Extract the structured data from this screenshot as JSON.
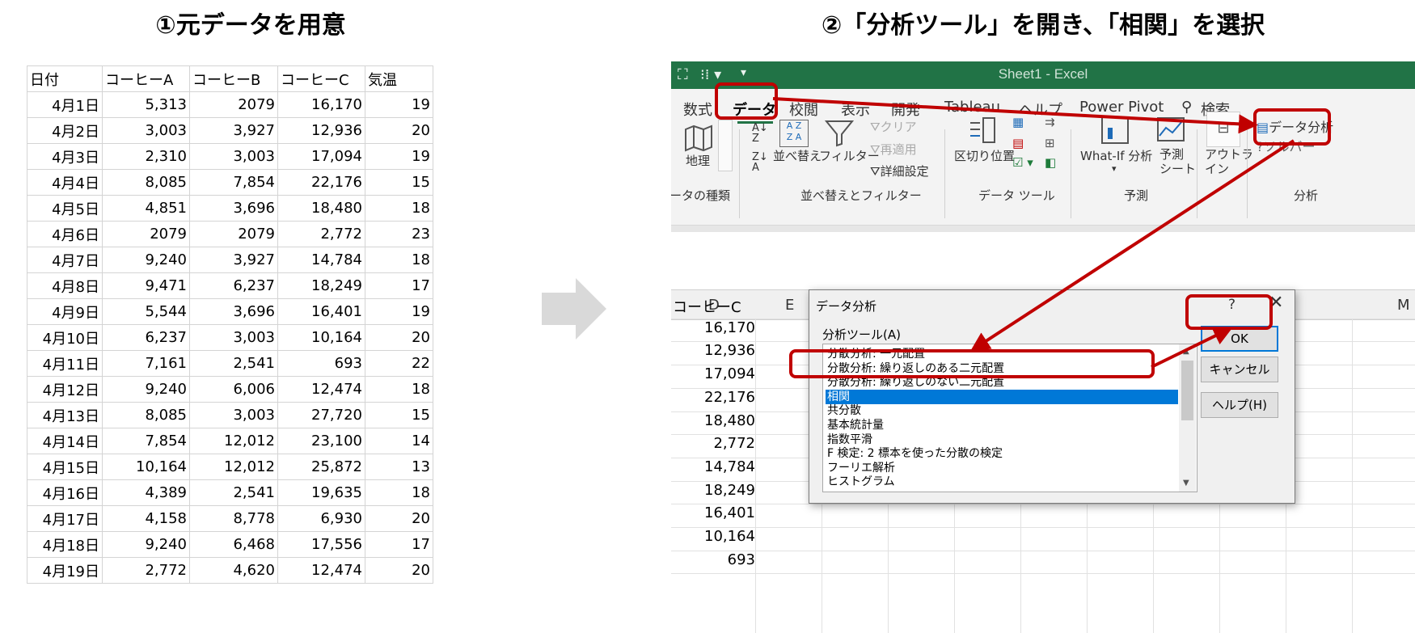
{
  "headings": {
    "step1": "①元データを用意",
    "step2": "②「分析ツール」を開き、「相関」を選択"
  },
  "source_table": {
    "headers": [
      "日付",
      "コーヒーA",
      "コーヒーB",
      "コーヒーC",
      "気温"
    ],
    "rows": [
      [
        "4月1日",
        "5,313",
        "2079",
        "16,170",
        "19"
      ],
      [
        "4月2日",
        "3,003",
        "3,927",
        "12,936",
        "20"
      ],
      [
        "4月3日",
        "2,310",
        "3,003",
        "17,094",
        "19"
      ],
      [
        "4月4日",
        "8,085",
        "7,854",
        "22,176",
        "15"
      ],
      [
        "4月5日",
        "4,851",
        "3,696",
        "18,480",
        "18"
      ],
      [
        "4月6日",
        "2079",
        "2079",
        "2,772",
        "23"
      ],
      [
        "4月7日",
        "9,240",
        "3,927",
        "14,784",
        "18"
      ],
      [
        "4月8日",
        "9,471",
        "6,237",
        "18,249",
        "17"
      ],
      [
        "4月9日",
        "5,544",
        "3,696",
        "16,401",
        "19"
      ],
      [
        "4月10日",
        "6,237",
        "3,003",
        "10,164",
        "20"
      ],
      [
        "4月11日",
        "7,161",
        "2,541",
        "693",
        "22"
      ],
      [
        "4月12日",
        "9,240",
        "6,006",
        "12,474",
        "18"
      ],
      [
        "4月13日",
        "8,085",
        "3,003",
        "27,720",
        "15"
      ],
      [
        "4月14日",
        "7,854",
        "12,012",
        "23,100",
        "14"
      ],
      [
        "4月15日",
        "10,164",
        "12,012",
        "25,872",
        "13"
      ],
      [
        "4月16日",
        "4,389",
        "2,541",
        "19,635",
        "18"
      ],
      [
        "4月17日",
        "4,158",
        "8,778",
        "6,930",
        "20"
      ],
      [
        "4月18日",
        "9,240",
        "6,468",
        "17,556",
        "17"
      ],
      [
        "4月19日",
        "2,772",
        "4,620",
        "12,474",
        "20"
      ]
    ]
  },
  "excel": {
    "title": "Sheet1  -  Excel",
    "tabs": [
      "数式",
      "データ",
      "校閲",
      "表示",
      "開発",
      "Tableau",
      "ヘルプ",
      "Power Pivot",
      "検索"
    ],
    "ribbon": {
      "geo": "地理",
      "sort": "並べ替え",
      "filter": "フィルター",
      "clear": "クリア",
      "reapply": "再適用",
      "advanced": "詳細設定",
      "text_to_columns": "区切り位置",
      "whatif": "What-If 分析",
      "forecast": "予測\nシート",
      "outline": "アウトラ\nイン",
      "data_analysis": "データ分析",
      "solver": "ソルバー",
      "group_types": "ータの種類",
      "group_sort": "並べ替えとフィルター",
      "group_tools": "データ ツール",
      "group_forecast": "予測",
      "group_analysis": "分析"
    },
    "columns": [
      "D",
      "E",
      "M"
    ],
    "col_d_header": "コーヒーC",
    "col_d_values": [
      "16,170",
      "12,936",
      "17,094",
      "22,176",
      "18,480",
      "2,772",
      "14,784",
      "18,249",
      "16,401",
      "10,164",
      "693"
    ]
  },
  "dialog": {
    "title": "データ分析",
    "help_glyph": "?",
    "close_glyph": "✕",
    "list_label": "分析ツール(A)",
    "items": [
      "分散分析: 一元配置",
      "分散分析: 繰り返しのある二元配置",
      "分散分析: 繰り返しのない二元配置",
      "相関",
      "共分散",
      "基本統計量",
      "指数平滑",
      "F 検定: 2 標本を使った分散の検定",
      "フーリエ解析",
      "ヒストグラム"
    ],
    "selected_index": 3,
    "ok": "OK",
    "cancel": "キャンセル",
    "help": "ヘルプ(H)"
  },
  "colors": {
    "excel_green": "#217346",
    "annotation_red": "#c00000",
    "selection_blue": "#0078d7",
    "arrow_gray": "#d9d9d9"
  }
}
